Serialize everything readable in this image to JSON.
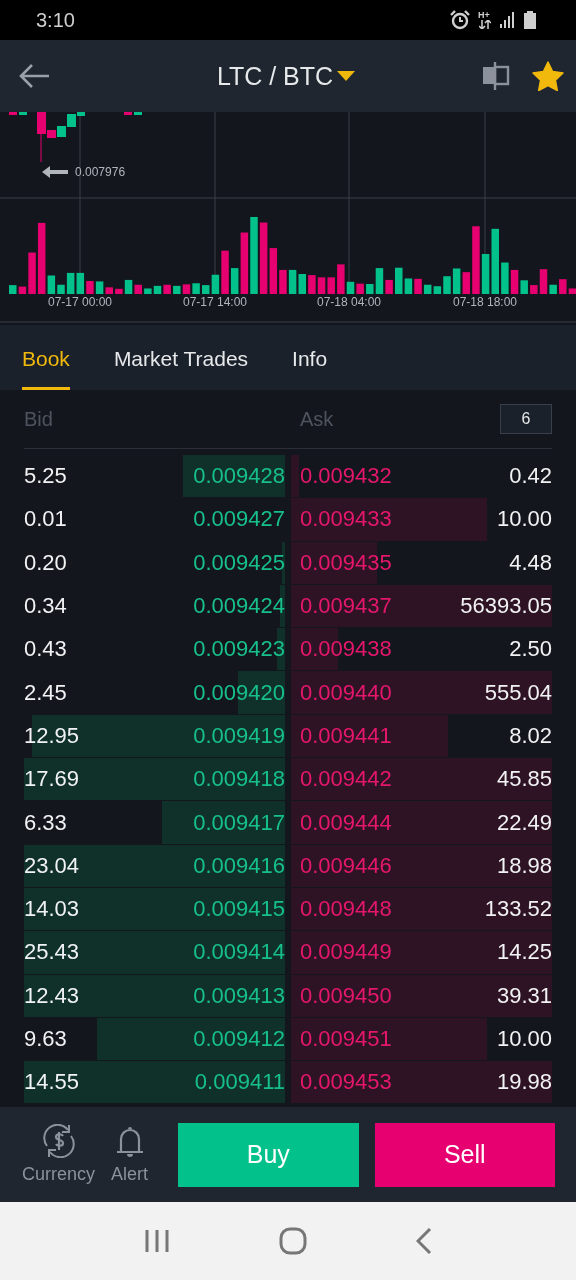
{
  "status_bar": {
    "time": "3:10",
    "network": "H+"
  },
  "header": {
    "title": "LTC / BTC",
    "favorite": true
  },
  "chart": {
    "price_marker": "0.007976",
    "time_labels": [
      "07-17 00:00",
      "07-17 14:00",
      "07-18 04:00",
      "07-18 18:00"
    ]
  },
  "tabs": [
    {
      "label": "Book",
      "selected": true
    },
    {
      "label": "Market Trades",
      "selected": false
    },
    {
      "label": "Info",
      "selected": false
    }
  ],
  "order_book": {
    "bid_label": "Bid",
    "ask_label": "Ask",
    "depth": "6",
    "rows": [
      {
        "bid": {
          "amount": "5.25",
          "price": "0.009428"
        },
        "ask": {
          "price": "0.009432",
          "amount": "0.42"
        }
      },
      {
        "bid": {
          "amount": "0.01",
          "price": "0.009427"
        },
        "ask": {
          "price": "0.009433",
          "amount": "10.00"
        }
      },
      {
        "bid": {
          "amount": "0.20",
          "price": "0.009425"
        },
        "ask": {
          "price": "0.009435",
          "amount": "4.48"
        }
      },
      {
        "bid": {
          "amount": "0.34",
          "price": "0.009424"
        },
        "ask": {
          "price": "0.009437",
          "amount": "56393.05"
        }
      },
      {
        "bid": {
          "amount": "0.43",
          "price": "0.009423"
        },
        "ask": {
          "price": "0.009438",
          "amount": "2.50"
        }
      },
      {
        "bid": {
          "amount": "2.45",
          "price": "0.009420"
        },
        "ask": {
          "price": "0.009440",
          "amount": "555.04"
        }
      },
      {
        "bid": {
          "amount": "12.95",
          "price": "0.009419"
        },
        "ask": {
          "price": "0.009441",
          "amount": "8.02"
        }
      },
      {
        "bid": {
          "amount": "17.69",
          "price": "0.009418"
        },
        "ask": {
          "price": "0.009442",
          "amount": "45.85"
        }
      },
      {
        "bid": {
          "amount": "6.33",
          "price": "0.009417"
        },
        "ask": {
          "price": "0.009444",
          "amount": "22.49"
        }
      },
      {
        "bid": {
          "amount": "23.04",
          "price": "0.009416"
        },
        "ask": {
          "price": "0.009446",
          "amount": "18.98"
        }
      },
      {
        "bid": {
          "amount": "14.03",
          "price": "0.009415"
        },
        "ask": {
          "price": "0.009448",
          "amount": "133.52"
        }
      },
      {
        "bid": {
          "amount": "25.43",
          "price": "0.009414"
        },
        "ask": {
          "price": "0.009449",
          "amount": "14.25"
        }
      },
      {
        "bid": {
          "amount": "12.43",
          "price": "0.009413"
        },
        "ask": {
          "price": "0.009450",
          "amount": "39.31"
        }
      },
      {
        "bid": {
          "amount": "9.63",
          "price": "0.009412"
        },
        "ask": {
          "price": "0.009451",
          "amount": "10.00"
        }
      },
      {
        "bid": {
          "amount": "14.55",
          "price": "0.009411"
        },
        "ask": {
          "price": "0.009453",
          "amount": "19.98"
        }
      }
    ]
  },
  "action_bar": {
    "items": [
      {
        "label": "Currency",
        "kind": "currency"
      },
      {
        "label": "Alert",
        "kind": "alert"
      }
    ],
    "buy": "Buy",
    "sell": "Sell"
  }
}
